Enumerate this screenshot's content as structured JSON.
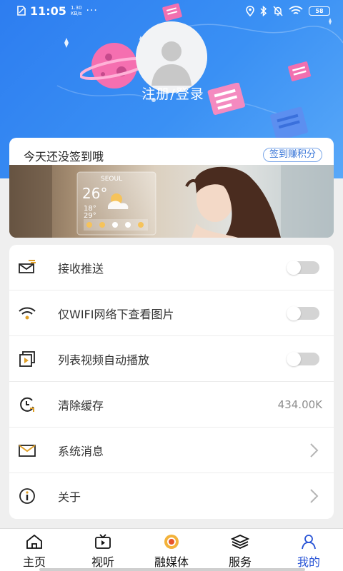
{
  "status_bar": {
    "time": "11:05",
    "net_speed_value": "1.30",
    "net_speed_unit": "KB/s",
    "more": "···",
    "battery": "58"
  },
  "profile": {
    "login_label": "注册/登录"
  },
  "signin": {
    "prompt": "今天还没签到哦",
    "button": "签到赚积分"
  },
  "banner": {
    "city": "SEOUL",
    "temperature": "26°",
    "temp_low": "18°",
    "temp_low2": "29°"
  },
  "settings": {
    "items": [
      {
        "label": "接收推送",
        "control": "toggle",
        "state": "off",
        "icon": "push-message-icon"
      },
      {
        "label": "仅WIFI网络下查看图片",
        "control": "toggle",
        "state": "off",
        "icon": "wifi-icon"
      },
      {
        "label": "列表视频自动播放",
        "control": "toggle",
        "state": "off",
        "icon": "video-autoplay-icon"
      },
      {
        "label": "清除缓存",
        "control": "value",
        "value": "434.00K",
        "icon": "clock-icon"
      },
      {
        "label": "系统消息",
        "control": "chevron",
        "icon": "mail-icon"
      },
      {
        "label": "关于",
        "control": "chevron",
        "icon": "info-icon"
      }
    ]
  },
  "tabbar": {
    "tabs": [
      {
        "label": "主页",
        "icon": "home-icon"
      },
      {
        "label": "视听",
        "icon": "tv-icon"
      },
      {
        "label": "融媒体",
        "icon": "media-logo-icon"
      },
      {
        "label": "服务",
        "icon": "layers-icon"
      },
      {
        "label": "我的",
        "icon": "user-icon",
        "active": true
      }
    ]
  },
  "colors": {
    "header_start": "#2d7df0",
    "header_end": "#58a8f8",
    "accent": "#2a55d6",
    "toggle_off": "#d4d4d4"
  }
}
